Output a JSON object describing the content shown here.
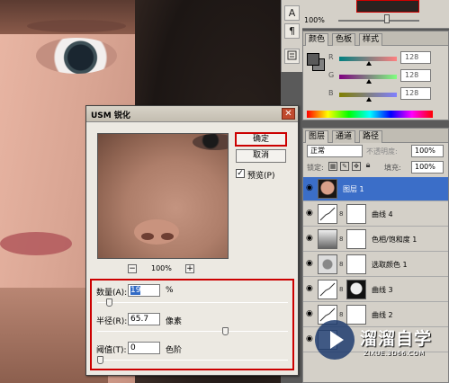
{
  "navigator": {
    "zoom": "100%"
  },
  "tools": {
    "text_icon": "A",
    "para_icon": "¶"
  },
  "color_panel": {
    "tabs": [
      "颜色",
      "色板",
      "样式"
    ],
    "channels": [
      {
        "name": "R",
        "value": "128"
      },
      {
        "name": "G",
        "value": "128"
      },
      {
        "name": "B",
        "value": "128"
      }
    ]
  },
  "layers_panel": {
    "tabs": [
      "图层",
      "通道",
      "路径"
    ],
    "blend_mode": "正常",
    "opacity_label": "不透明度:",
    "opacity_value": "100%",
    "lock_label": "锁定:",
    "fill_label": "填充:",
    "fill_value": "100%",
    "layers": [
      {
        "name": "图层 1",
        "selected": true
      },
      {
        "name": "曲线 4",
        "selected": false
      },
      {
        "name": "色相/饱和度 1",
        "selected": false
      },
      {
        "name": "选取颜色 1",
        "selected": false
      },
      {
        "name": "曲线 3",
        "selected": false
      },
      {
        "name": "曲线 2",
        "selected": false
      },
      {
        "name": "",
        "selected": false
      }
    ]
  },
  "usm_dialog": {
    "title": "USM 锐化",
    "ok_label": "确定",
    "cancel_label": "取消",
    "preview_label": "预览(P)",
    "preview_checked": true,
    "zoom_level": "100%",
    "amount": {
      "label": "数量(A):",
      "value": "19",
      "unit": "%",
      "level": 0.05
    },
    "radius": {
      "label": "半径(R):",
      "value": "65.7",
      "unit": "像素",
      "level": 0.68
    },
    "threshold": {
      "label": "阈值(T):",
      "value": "0",
      "unit": "色阶",
      "level": 0.0
    }
  },
  "watermark": {
    "title": "溜溜自学",
    "url": "ZIXUE.3D66.COM"
  },
  "icons": {
    "close": "close-icon",
    "eye": "eye-icon",
    "link": "link-icon",
    "zoom_in": "zoom-in-icon",
    "zoom_out": "zoom-out-icon"
  }
}
